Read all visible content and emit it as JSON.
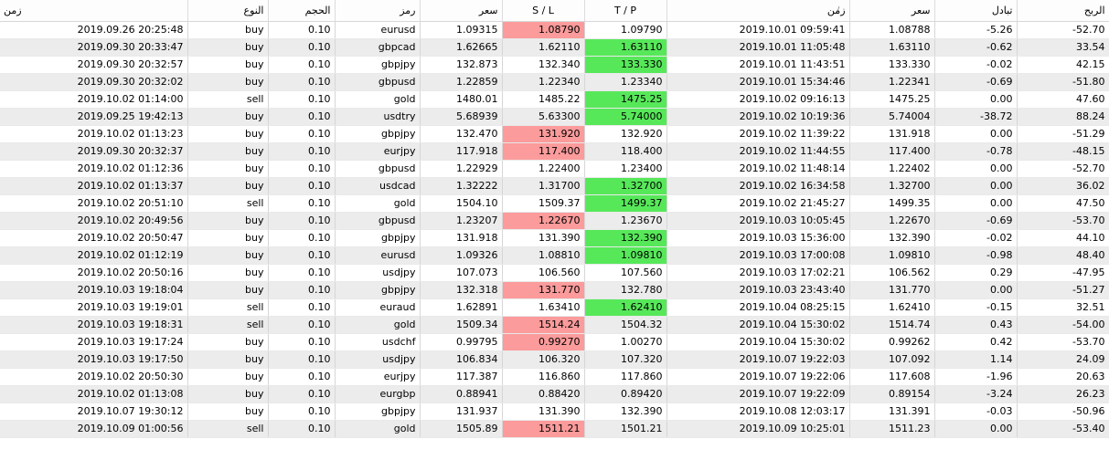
{
  "headers": {
    "open_time": "زمن",
    "type": "النوع",
    "volume": "الحجم",
    "symbol": "رمز",
    "open_price": "سعر",
    "sl": "S / L",
    "tp": "T / P",
    "close_time": "زمن",
    "close_price": "سعر",
    "swap": "تبادل",
    "profit": "الربح"
  },
  "sort_icon": "/",
  "colors": {
    "sl_hit": "#fb9b9b",
    "tp_hit": "#57e85a",
    "row_alt": "#ececec"
  },
  "rows": [
    {
      "open_time": "2019.09.26 20:25:48",
      "type": "buy",
      "volume": "0.10",
      "symbol": "eurusd",
      "open_price": "1.09315",
      "sl": "1.08790",
      "tp": "1.09790",
      "close_time": "2019.10.01 09:59:41",
      "close_price": "1.08788",
      "swap": "-5.26",
      "profit": "-52.70",
      "hit": "sl"
    },
    {
      "open_time": "2019.09.30 20:33:47",
      "type": "buy",
      "volume": "0.10",
      "symbol": "gbpcad",
      "open_price": "1.62665",
      "sl": "1.62110",
      "tp": "1.63110",
      "close_time": "2019.10.01 11:05:48",
      "close_price": "1.63110",
      "swap": "-0.62",
      "profit": "33.54",
      "hit": "tp"
    },
    {
      "open_time": "2019.09.30 20:32:57",
      "type": "buy",
      "volume": "0.10",
      "symbol": "gbpjpy",
      "open_price": "132.873",
      "sl": "132.340",
      "tp": "133.330",
      "close_time": "2019.10.01 11:43:51",
      "close_price": "133.330",
      "swap": "-0.02",
      "profit": "42.15",
      "hit": "tp"
    },
    {
      "open_time": "2019.09.30 20:32:02",
      "type": "buy",
      "volume": "0.10",
      "symbol": "gbpusd",
      "open_price": "1.22859",
      "sl": "1.22340",
      "tp": "1.23340",
      "close_time": "2019.10.01 15:34:46",
      "close_price": "1.22341",
      "swap": "-0.69",
      "profit": "-51.80",
      "hit": ""
    },
    {
      "open_time": "2019.10.02 01:14:00",
      "type": "sell",
      "volume": "0.10",
      "symbol": "gold",
      "open_price": "1480.01",
      "sl": "1485.22",
      "tp": "1475.25",
      "close_time": "2019.10.02 09:16:13",
      "close_price": "1475.25",
      "swap": "0.00",
      "profit": "47.60",
      "hit": "tp"
    },
    {
      "open_time": "2019.09.25 19:42:13",
      "type": "buy",
      "volume": "0.10",
      "symbol": "usdtry",
      "open_price": "5.68939",
      "sl": "5.63300",
      "tp": "5.74000",
      "close_time": "2019.10.02 10:19:36",
      "close_price": "5.74004",
      "swap": "-38.72",
      "profit": "88.24",
      "hit": "tp"
    },
    {
      "open_time": "2019.10.02 01:13:23",
      "type": "buy",
      "volume": "0.10",
      "symbol": "gbpjpy",
      "open_price": "132.470",
      "sl": "131.920",
      "tp": "132.920",
      "close_time": "2019.10.02 11:39:22",
      "close_price": "131.918",
      "swap": "0.00",
      "profit": "-51.29",
      "hit": "sl"
    },
    {
      "open_time": "2019.09.30 20:32:37",
      "type": "buy",
      "volume": "0.10",
      "symbol": "eurjpy",
      "open_price": "117.918",
      "sl": "117.400",
      "tp": "118.400",
      "close_time": "2019.10.02 11:44:55",
      "close_price": "117.400",
      "swap": "-0.78",
      "profit": "-48.15",
      "hit": "sl"
    },
    {
      "open_time": "2019.10.02 01:12:36",
      "type": "buy",
      "volume": "0.10",
      "symbol": "gbpusd",
      "open_price": "1.22929",
      "sl": "1.22400",
      "tp": "1.23400",
      "close_time": "2019.10.02 11:48:14",
      "close_price": "1.22402",
      "swap": "0.00",
      "profit": "-52.70",
      "hit": ""
    },
    {
      "open_time": "2019.10.02 01:13:37",
      "type": "buy",
      "volume": "0.10",
      "symbol": "usdcad",
      "open_price": "1.32222",
      "sl": "1.31700",
      "tp": "1.32700",
      "close_time": "2019.10.02 16:34:58",
      "close_price": "1.32700",
      "swap": "0.00",
      "profit": "36.02",
      "hit": "tp"
    },
    {
      "open_time": "2019.10.02 20:51:10",
      "type": "sell",
      "volume": "0.10",
      "symbol": "gold",
      "open_price": "1504.10",
      "sl": "1509.37",
      "tp": "1499.37",
      "close_time": "2019.10.02 21:45:27",
      "close_price": "1499.35",
      "swap": "0.00",
      "profit": "47.50",
      "hit": "tp"
    },
    {
      "open_time": "2019.10.02 20:49:56",
      "type": "buy",
      "volume": "0.10",
      "symbol": "gbpusd",
      "open_price": "1.23207",
      "sl": "1.22670",
      "tp": "1.23670",
      "close_time": "2019.10.03 10:05:45",
      "close_price": "1.22670",
      "swap": "-0.69",
      "profit": "-53.70",
      "hit": "sl"
    },
    {
      "open_time": "2019.10.02 20:50:47",
      "type": "buy",
      "volume": "0.10",
      "symbol": "gbpjpy",
      "open_price": "131.918",
      "sl": "131.390",
      "tp": "132.390",
      "close_time": "2019.10.03 15:36:00",
      "close_price": "132.390",
      "swap": "-0.02",
      "profit": "44.10",
      "hit": "tp"
    },
    {
      "open_time": "2019.10.02 01:12:19",
      "type": "buy",
      "volume": "0.10",
      "symbol": "eurusd",
      "open_price": "1.09326",
      "sl": "1.08810",
      "tp": "1.09810",
      "close_time": "2019.10.03 17:00:08",
      "close_price": "1.09810",
      "swap": "-0.98",
      "profit": "48.40",
      "hit": "tp"
    },
    {
      "open_time": "2019.10.02 20:50:16",
      "type": "buy",
      "volume": "0.10",
      "symbol": "usdjpy",
      "open_price": "107.073",
      "sl": "106.560",
      "tp": "107.560",
      "close_time": "2019.10.03 17:02:21",
      "close_price": "106.562",
      "swap": "0.29",
      "profit": "-47.95",
      "hit": ""
    },
    {
      "open_time": "2019.10.03 19:18:04",
      "type": "buy",
      "volume": "0.10",
      "symbol": "gbpjpy",
      "open_price": "132.318",
      "sl": "131.770",
      "tp": "132.780",
      "close_time": "2019.10.03 23:43:40",
      "close_price": "131.770",
      "swap": "0.00",
      "profit": "-51.27",
      "hit": "sl"
    },
    {
      "open_time": "2019.10.03 19:19:01",
      "type": "sell",
      "volume": "0.10",
      "symbol": "euraud",
      "open_price": "1.62891",
      "sl": "1.63410",
      "tp": "1.62410",
      "close_time": "2019.10.04 08:25:15",
      "close_price": "1.62410",
      "swap": "-0.15",
      "profit": "32.51",
      "hit": "tp"
    },
    {
      "open_time": "2019.10.03 19:18:31",
      "type": "sell",
      "volume": "0.10",
      "symbol": "gold",
      "open_price": "1509.34",
      "sl": "1514.24",
      "tp": "1504.32",
      "close_time": "2019.10.04 15:30:02",
      "close_price": "1514.74",
      "swap": "0.43",
      "profit": "-54.00",
      "hit": "sl"
    },
    {
      "open_time": "2019.10.03 19:17:24",
      "type": "buy",
      "volume": "0.10",
      "symbol": "usdchf",
      "open_price": "0.99795",
      "sl": "0.99270",
      "tp": "1.00270",
      "close_time": "2019.10.04 15:30:02",
      "close_price": "0.99262",
      "swap": "0.42",
      "profit": "-53.70",
      "hit": "sl"
    },
    {
      "open_time": "2019.10.03 19:17:50",
      "type": "buy",
      "volume": "0.10",
      "symbol": "usdjpy",
      "open_price": "106.834",
      "sl": "106.320",
      "tp": "107.320",
      "close_time": "2019.10.07 19:22:03",
      "close_price": "107.092",
      "swap": "1.14",
      "profit": "24.09",
      "hit": ""
    },
    {
      "open_time": "2019.10.02 20:50:30",
      "type": "buy",
      "volume": "0.10",
      "symbol": "eurjpy",
      "open_price": "117.387",
      "sl": "116.860",
      "tp": "117.860",
      "close_time": "2019.10.07 19:22:06",
      "close_price": "117.608",
      "swap": "-1.96",
      "profit": "20.63",
      "hit": ""
    },
    {
      "open_time": "2019.10.02 01:13:08",
      "type": "buy",
      "volume": "0.10",
      "symbol": "eurgbp",
      "open_price": "0.88941",
      "sl": "0.88420",
      "tp": "0.89420",
      "close_time": "2019.10.07 19:22:09",
      "close_price": "0.89154",
      "swap": "-3.24",
      "profit": "26.23",
      "hit": ""
    },
    {
      "open_time": "2019.10.07 19:30:12",
      "type": "buy",
      "volume": "0.10",
      "symbol": "gbpjpy",
      "open_price": "131.937",
      "sl": "131.390",
      "tp": "132.390",
      "close_time": "2019.10.08 12:03:17",
      "close_price": "131.391",
      "swap": "-0.03",
      "profit": "-50.96",
      "hit": ""
    },
    {
      "open_time": "2019.10.09 01:00:56",
      "type": "sell",
      "volume": "0.10",
      "symbol": "gold",
      "open_price": "1505.89",
      "sl": "1511.21",
      "tp": "1501.21",
      "close_time": "2019.10.09 10:25:01",
      "close_price": "1511.23",
      "swap": "0.00",
      "profit": "-53.40",
      "hit": "sl"
    }
  ]
}
